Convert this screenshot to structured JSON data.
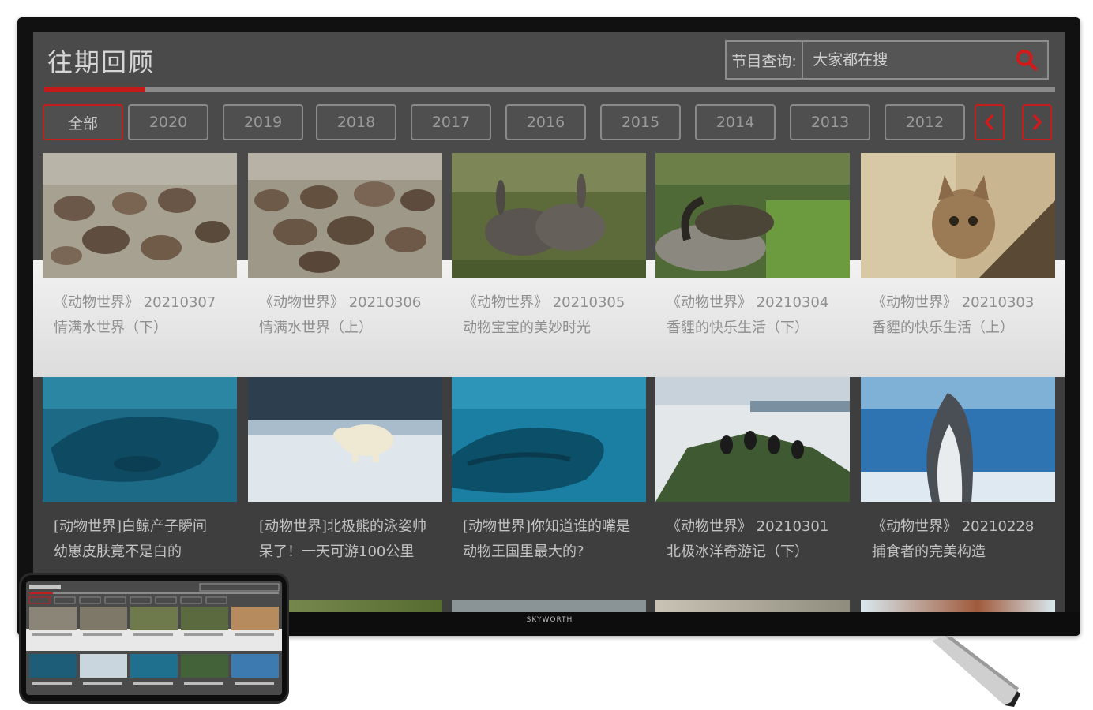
{
  "app": {
    "title": "往期回顾",
    "brand": "SKYWORTH"
  },
  "search": {
    "label": "节目查询:",
    "placeholder": "大家都在搜",
    "icon": "search-icon"
  },
  "colors": {
    "accent": "#c51d1d",
    "screen_bg": "#4a4a4a",
    "light_row_bg": "#ececec",
    "dark_row_bg": "#3e3e3e"
  },
  "progress": {
    "fraction": 0.1
  },
  "filters": [
    {
      "label": "全部",
      "active": true
    },
    {
      "label": "2020",
      "active": false
    },
    {
      "label": "2019",
      "active": false
    },
    {
      "label": "2018",
      "active": false
    },
    {
      "label": "2017",
      "active": false
    },
    {
      "label": "2016",
      "active": false
    },
    {
      "label": "2015",
      "active": false
    },
    {
      "label": "2014",
      "active": false
    },
    {
      "label": "2013",
      "active": false
    },
    {
      "label": "2012",
      "active": false
    }
  ],
  "nav": {
    "prev_icon": "chevron-left-icon",
    "next_icon": "chevron-right-icon"
  },
  "rows": [
    [
      {
        "title": "《动物世界》 20210307",
        "subtitle": "情满水世界（下）",
        "thumb": "walrus-herd"
      },
      {
        "title": "《动物世界》 20210306",
        "subtitle": "情满水世界（上）",
        "thumb": "walrus-colony"
      },
      {
        "title": "《动物世界》 20210305",
        "subtitle": "动物宝宝的美妙时光",
        "thumb": "rabbits"
      },
      {
        "title": "《动物世界》 20210304",
        "subtitle": "香貍的快乐生活（下）",
        "thumb": "genet-water"
      },
      {
        "title": "《动物世界》 20210303",
        "subtitle": "香貍的快乐生活（上）",
        "thumb": "genet-tree"
      }
    ],
    [
      {
        "title": "[动物世界]白鲸产子瞬间",
        "subtitle": "幼崽皮肤竟不是白的",
        "thumb": "beluga"
      },
      {
        "title": "[动物世界]北极熊的泳姿帅",
        "subtitle": "呆了！一天可游100公里",
        "thumb": "polar-bear"
      },
      {
        "title": "[动物世界]你知道谁的嘴是",
        "subtitle": "动物王国里最大的?",
        "thumb": "whale"
      },
      {
        "title": "《动物世界》 20210301",
        "subtitle": "北极冰洋奇游记（下）",
        "thumb": "birds-cliff"
      },
      {
        "title": "《动物世界》 20210228",
        "subtitle": "捕食者的完美构造",
        "thumb": "shark"
      }
    ]
  ]
}
